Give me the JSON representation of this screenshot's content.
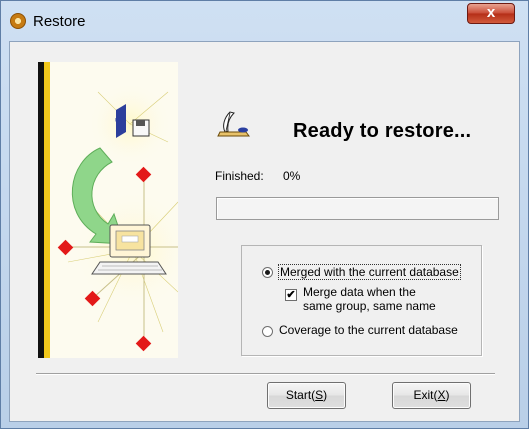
{
  "window": {
    "title": "Restore",
    "close_glyph": "x"
  },
  "main": {
    "heading": "Ready to restore...",
    "finished_label": "Finished:",
    "finished_value": "0%",
    "progress": 0
  },
  "options": {
    "opt_merge": {
      "label": "Merged with the current database",
      "selected": true
    },
    "merge_same_group": {
      "line1": "Merge data when the",
      "line2": "same group, same name",
      "checked": true
    },
    "opt_coverage": {
      "label": "Coverage to the current database",
      "selected": false
    }
  },
  "buttons": {
    "start": {
      "label": "Start(",
      "hotkey": "S",
      "end": ")"
    },
    "exit": {
      "label": "Exit(",
      "hotkey": "X",
      "end": ")"
    }
  },
  "icons": {
    "title": "restore-app-icon",
    "quill": "quill-icon",
    "check_glyph": "✔"
  },
  "colors": {
    "close_button": "#c94a35",
    "art_yellow": "#f2c81c",
    "diamond_red": "#e31919",
    "arrow_green": "#8fd68a"
  }
}
